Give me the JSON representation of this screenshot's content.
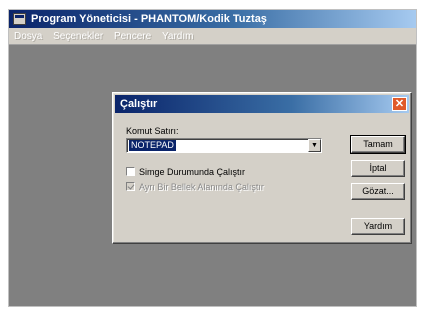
{
  "window": {
    "title": "Program Yöneticisi - PHANTOM/Kodik Tuztaş"
  },
  "menubar": {
    "items": [
      "Dosya",
      "Seçenekler",
      "Pencere",
      "Yardım"
    ]
  },
  "dialog": {
    "title": "Çalıştır",
    "close_glyph": "✕",
    "command_label": "Komut Satırı:",
    "command_value": "NOTEPAD",
    "dropdown_glyph": "▼",
    "run_minimized_label": "Simge Durumunda Çalıştır",
    "run_minimized_checked": false,
    "separate_memory_label": "Ayrı Bir Bellek Alanında Çalıştır",
    "separate_memory_checked": true,
    "separate_memory_enabled": false,
    "buttons": {
      "ok": "Tamam",
      "cancel": "İptal",
      "browse": "Gözat...",
      "help": "Yardım"
    }
  },
  "colors": {
    "titlebar_active": "#0a246a",
    "face": "#d4d0c8",
    "workspace": "#808080",
    "close_button": "#e05a2a"
  }
}
